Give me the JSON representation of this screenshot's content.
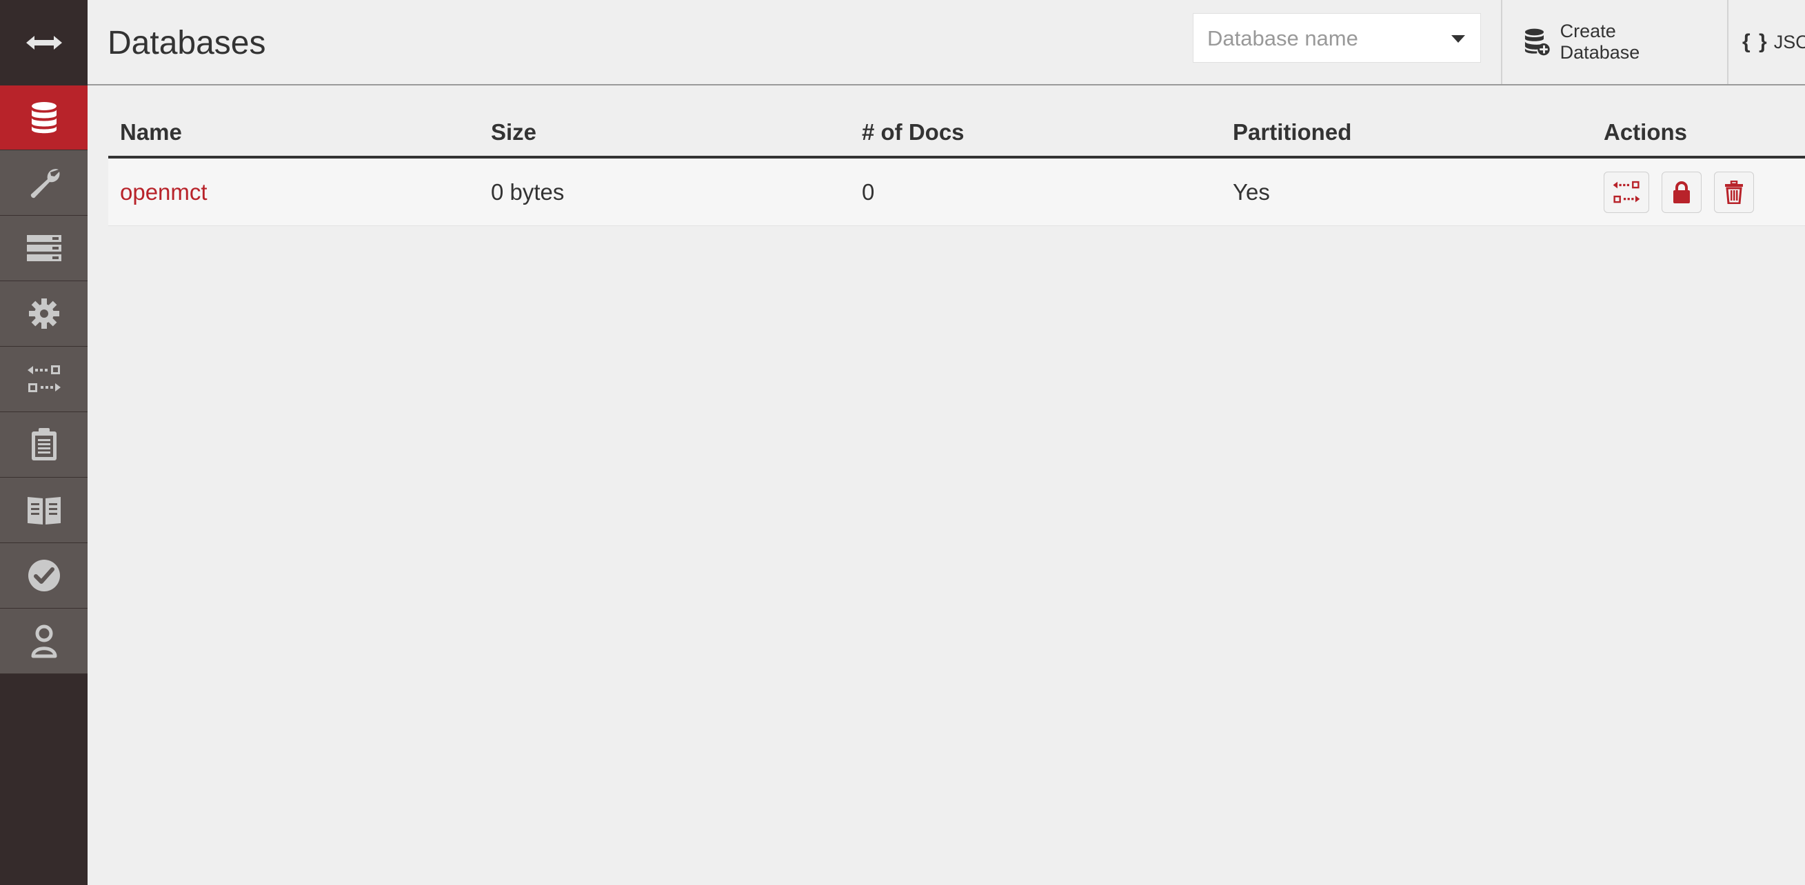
{
  "header": {
    "title": "Databases",
    "search_placeholder": "Database name",
    "search_value": "",
    "create_label": "Create Database",
    "json_braces": "{ }",
    "json_label": "JSON"
  },
  "sidebar": {
    "toggle_icon": "double-arrow-icon",
    "items": [
      {
        "icon": "database-icon",
        "active": true
      },
      {
        "icon": "wrench-icon",
        "active": false
      },
      {
        "icon": "server-icon",
        "active": false
      },
      {
        "icon": "gear-icon",
        "active": false
      },
      {
        "icon": "replication-icon",
        "active": false
      },
      {
        "icon": "clipboard-icon",
        "active": false
      },
      {
        "icon": "book-icon",
        "active": false
      },
      {
        "icon": "check-circle-icon",
        "active": false
      },
      {
        "icon": "user-icon",
        "active": false
      }
    ]
  },
  "table": {
    "columns": [
      "Name",
      "Size",
      "# of Docs",
      "Partitioned",
      "Actions"
    ],
    "rows": [
      {
        "name": "openmct",
        "size": "0 bytes",
        "docs": "0",
        "partitioned": "Yes",
        "actions": [
          "replication-icon",
          "lock-icon",
          "trash-icon"
        ]
      }
    ]
  },
  "colors": {
    "accent": "#b8232a",
    "sidebar_bg": "#352b2b",
    "sidebar_item_bg": "#5d5654",
    "page_bg": "#efefef"
  }
}
